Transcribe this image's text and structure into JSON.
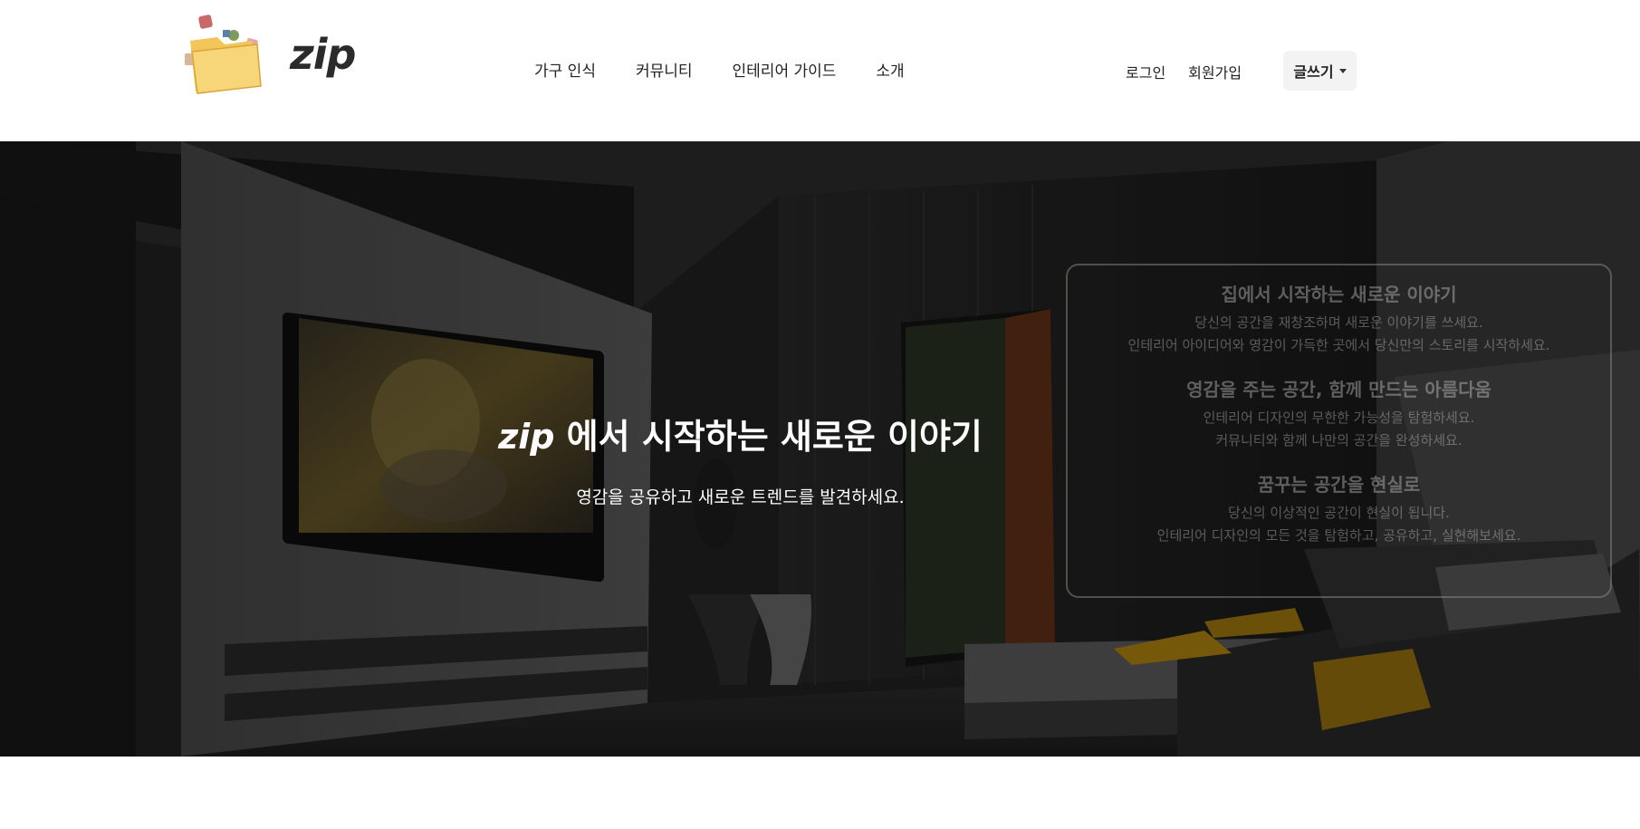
{
  "brand": {
    "name": "zip"
  },
  "nav": {
    "items": [
      {
        "label": "가구 인식"
      },
      {
        "label": "커뮤니티"
      },
      {
        "label": "인테리어 가이드"
      },
      {
        "label": "소개"
      }
    ]
  },
  "auth": {
    "login": "로그인",
    "signup": "회원가입"
  },
  "write_button": {
    "label": "글쓰기"
  },
  "hero": {
    "title_brand": "zip",
    "title_rest": "에서 시작하는 새로운 이야기",
    "subtitle": "영감을 공유하고 새로운 트렌드를 발견하세요."
  },
  "info_box": {
    "sections": [
      {
        "heading": "집에서 시작하는 새로운 이야기",
        "lines": [
          "당신의 공간을 재창조하며 새로운 이야기를 쓰세요.",
          "인테리어 아이디어와 영감이 가득한 곳에서 당신만의 스토리를 시작하세요."
        ]
      },
      {
        "heading": "영감을 주는 공간, 함께 만드는 아름다움",
        "lines": [
          "인테리어 디자인의 무한한 가능성을 탐험하세요.",
          "커뮤니티와 함께 나만의 공간을 완성하세요."
        ]
      },
      {
        "heading": "꿈꾸는 공간을 현실로",
        "lines": [
          "당신의 이상적인 공간이 현실이 됩니다.",
          "인테리어 디자인의 모든 것을 탐험하고, 공유하고, 실현해보세요."
        ]
      }
    ]
  },
  "colors": {
    "hero_overlay": "#000000",
    "sofa_accent": "#c89a10",
    "text_primary": "#222222"
  },
  "icons": {
    "logo": "folder-logo-icon",
    "write_dropdown": "caret-down-icon"
  }
}
